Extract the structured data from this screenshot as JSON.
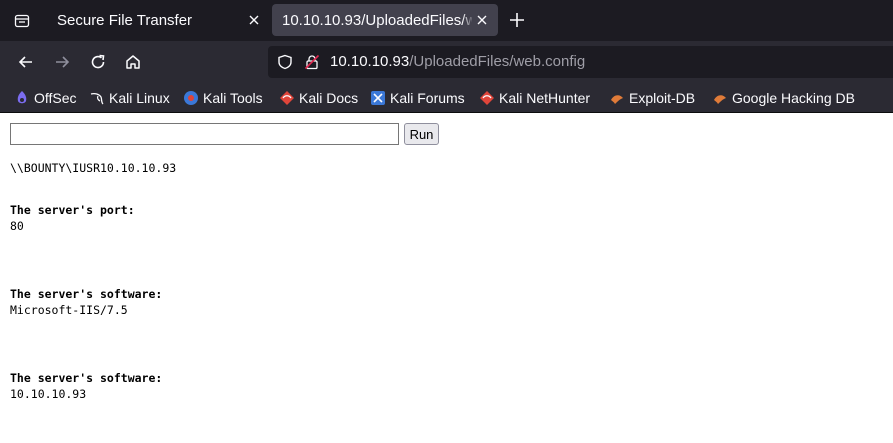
{
  "tabs": [
    {
      "label": "Secure File Transfer",
      "active": false
    },
    {
      "label": "10.10.10.93/UploadedFiles/web.config",
      "active": true
    }
  ],
  "urlbar": {
    "host": "10.10.10.93",
    "path": "/UploadedFiles/web.config"
  },
  "bookmarks": [
    {
      "label": "OffSec",
      "icon": "offsec-icon"
    },
    {
      "label": "Kali Linux",
      "icon": "kali-dragon-icon"
    },
    {
      "label": "Kali Tools",
      "icon": "kali-tools-icon"
    },
    {
      "label": "Kali Docs",
      "icon": "kali-docs-icon"
    },
    {
      "label": "Kali Forums",
      "icon": "kali-forums-icon"
    },
    {
      "label": "Kali NetHunter",
      "icon": "kali-nethunter-icon"
    },
    {
      "label": "Exploit-DB",
      "icon": "exploit-db-icon"
    },
    {
      "label": "Google Hacking DB",
      "icon": "ghdb-icon"
    }
  ],
  "page": {
    "input_value": "",
    "run_label": "Run",
    "whoami": "\\\\BOUNTY\\IUSR10.10.10.93",
    "sections": [
      {
        "heading": "The server's port:",
        "value": "80"
      },
      {
        "heading": "The server's software:",
        "value": "Microsoft-IIS/7.5"
      },
      {
        "heading": "The server's software:",
        "value": "10.10.10.93"
      }
    ]
  },
  "colors": {
    "tabstrip_bg": "#1c1b22",
    "toolbar_bg": "#2b2a33",
    "active_tab_bg": "#42414d",
    "url_path": "#9f9ea7"
  }
}
